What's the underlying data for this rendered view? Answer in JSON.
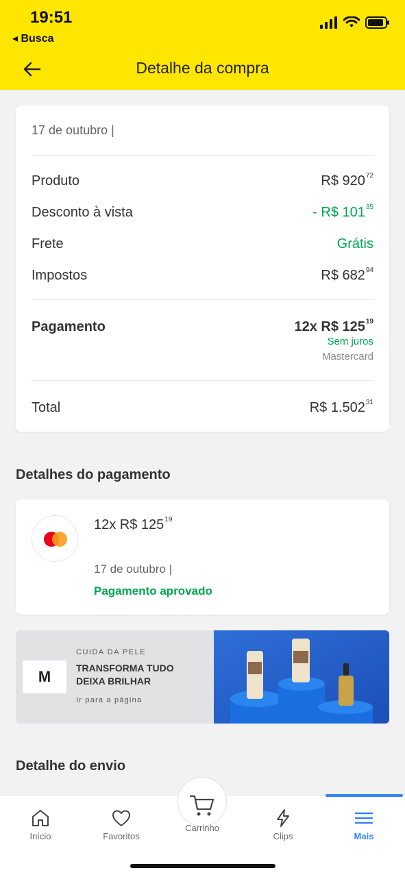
{
  "status_bar": {
    "time": "19:51",
    "back_app": "◂ Busca"
  },
  "header": {
    "title": "Detalhe da compra"
  },
  "summary": {
    "date": "17 de outubro |",
    "rows": [
      {
        "label": "Produto",
        "value": "R$ 920",
        "cents": "72"
      },
      {
        "label": "Desconto à vista",
        "value": "- R$ 101",
        "cents": "35"
      },
      {
        "label": "Frete",
        "value": "Grátis",
        "cents": ""
      },
      {
        "label": "Impostos",
        "value": "R$ 682",
        "cents": "94"
      }
    ],
    "payment": {
      "label": "Pagamento",
      "installments": "12x R$ 125",
      "cents": "19",
      "interest": "Sem juros",
      "card_brand": "Mastercard"
    },
    "total": {
      "label": "Total",
      "value": "R$ 1.502",
      "cents": "31"
    }
  },
  "payment_details": {
    "title": "Detalhes do pagamento",
    "amount": "12x R$ 125",
    "cents": "19",
    "date": "17 de outubro |",
    "status": "Pagamento aprovado"
  },
  "ad": {
    "logo": "M",
    "kicker": "CUIDA DA PELE",
    "headline_1": "TRANSFORMA TUDO",
    "headline_2": "DEIXA BRILHAR",
    "link": "Ir para a página"
  },
  "shipping": {
    "title": "Detalhe do envio"
  },
  "nav": {
    "items": [
      {
        "label": "Início",
        "icon": "home-icon"
      },
      {
        "label": "Favoritos",
        "icon": "heart-icon"
      },
      {
        "label": "Carrinho",
        "icon": "cart-icon"
      },
      {
        "label": "Clips",
        "icon": "lightning-icon"
      },
      {
        "label": "Mais",
        "icon": "menu-icon"
      }
    ],
    "active_color": "#3483fa"
  },
  "colors": {
    "header": "#ffe600",
    "green": "#00a650",
    "accent": "#3483fa"
  }
}
